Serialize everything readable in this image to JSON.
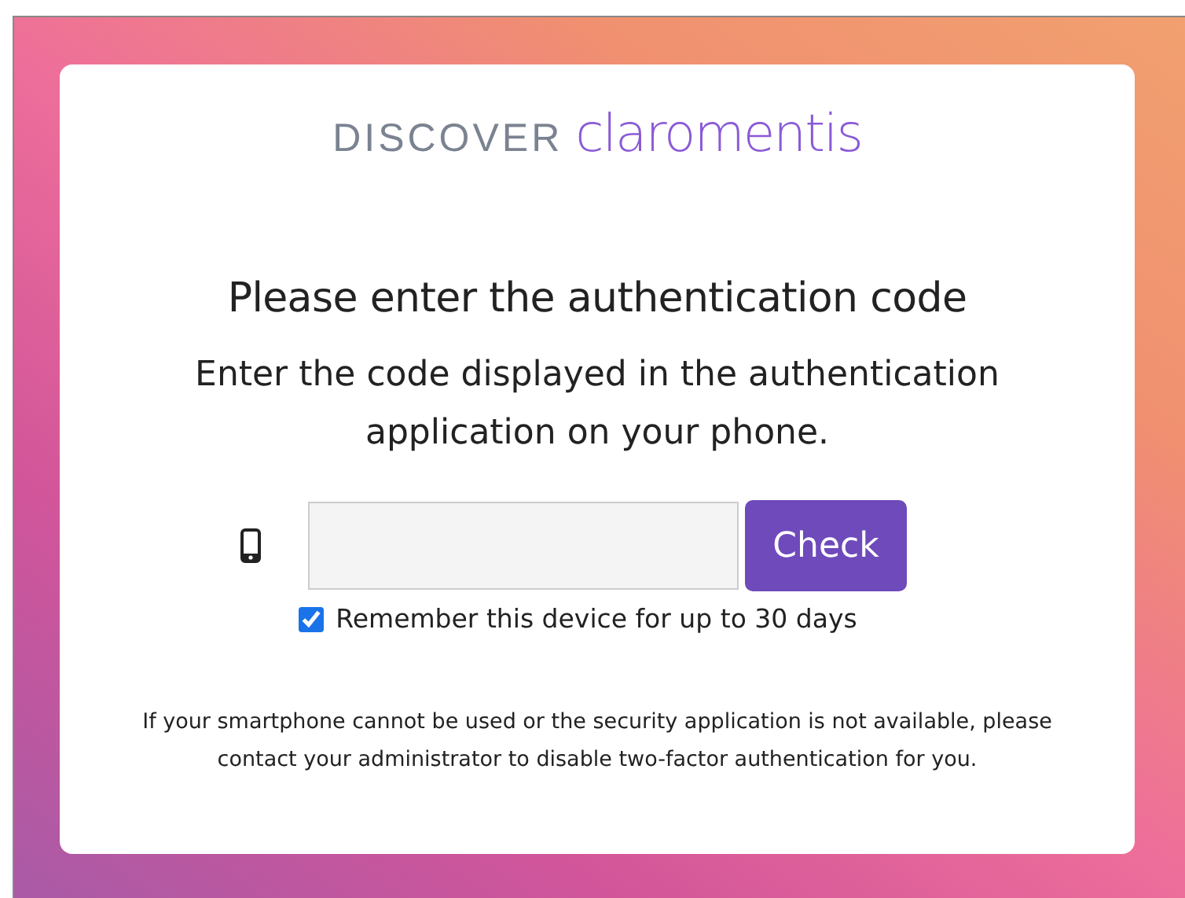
{
  "logo": {
    "prefix": "DISCOVER",
    "name": "claromentis"
  },
  "heading": "Please enter the authentication code",
  "instructions": "Enter the code displayed in the authentication application on your phone.",
  "check_button": "Check",
  "remember": {
    "label": "Remember this device for up to 30 days",
    "checked": true
  },
  "note": "If your smartphone cannot be used or the security application is not available, please contact your administrator to disable two-factor authentication for you."
}
